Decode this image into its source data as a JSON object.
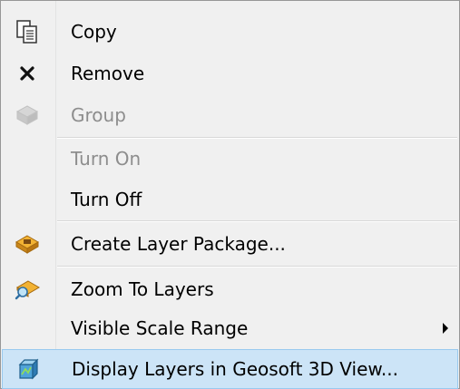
{
  "menu": {
    "items": [
      {
        "label": "Copy",
        "icon": "copy-icon",
        "disabled": false
      },
      {
        "label": "Remove",
        "icon": "remove-icon",
        "disabled": false
      },
      {
        "label": "Group",
        "icon": "group-icon",
        "disabled": true
      },
      {
        "label": "Turn On",
        "icon": "",
        "disabled": true
      },
      {
        "label": "Turn Off",
        "icon": "",
        "disabled": false
      },
      {
        "label": "Create Layer Package...",
        "icon": "layer-package-icon",
        "disabled": false
      },
      {
        "label": "Zoom To Layers",
        "icon": "zoom-to-layers-icon",
        "disabled": false
      },
      {
        "label": "Visible Scale Range",
        "icon": "",
        "disabled": false,
        "submenu": true
      },
      {
        "label": "Display Layers in Geosoft 3D View...",
        "icon": "geosoft-3d-icon",
        "disabled": false,
        "highlighted": true
      }
    ]
  },
  "colors": {
    "highlight": "#cce4f7",
    "highlight_border": "#99c9ef",
    "disabled_text": "#8d8d8d"
  }
}
